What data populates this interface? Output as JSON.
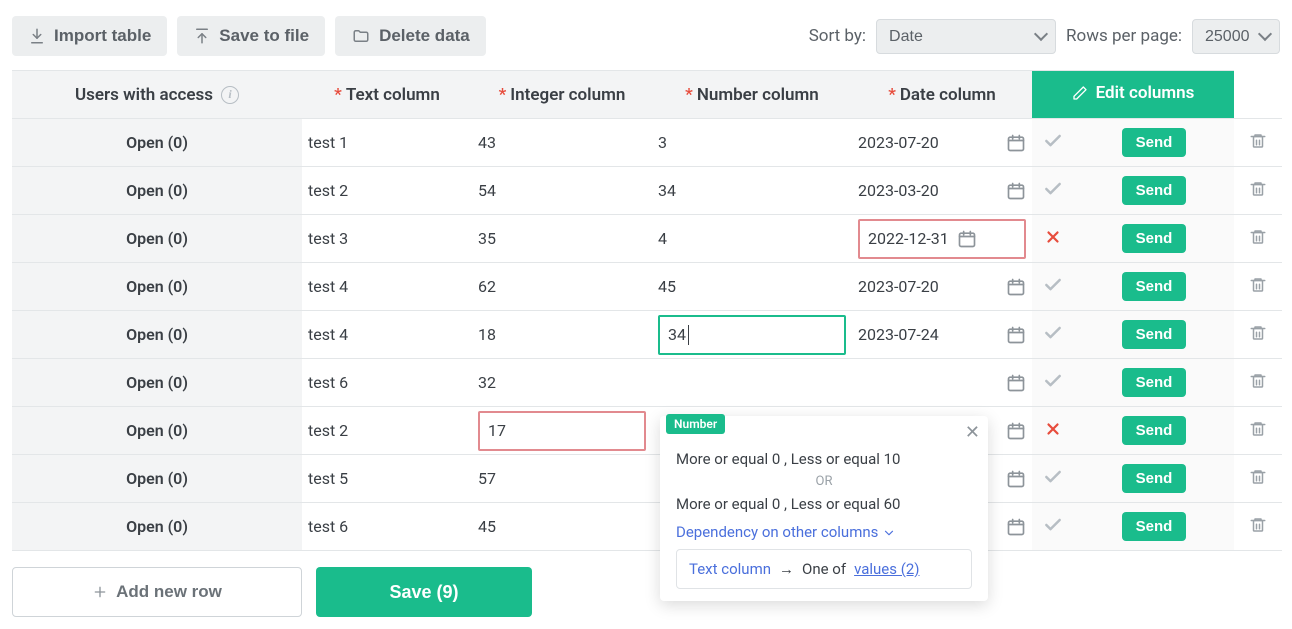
{
  "toolbar": {
    "import_label": "Import table",
    "save_file_label": "Save to file",
    "delete_data_label": "Delete data",
    "sort_by_label": "Sort by:",
    "sort_selected": "Date",
    "rows_label": "Rows per page:",
    "rows_selected": "25000"
  },
  "columns": {
    "users": "Users with access",
    "text": "Text column",
    "integer": "Integer column",
    "number": "Number column",
    "date": "Date column",
    "edit": "Edit columns"
  },
  "rows": [
    {
      "users": "Open (0)",
      "text": "test 1",
      "int": "43",
      "num": "3",
      "date": "2023-07-20",
      "status": "ok",
      "send": "Send"
    },
    {
      "users": "Open (0)",
      "text": "test 2",
      "int": "54",
      "num": "34",
      "date": "2023-03-20",
      "status": "ok",
      "send": "Send"
    },
    {
      "users": "Open (0)",
      "text": "test 3",
      "int": "35",
      "num": "4",
      "date": "2022-12-31",
      "status": "err",
      "send": "Send",
      "date_err": true
    },
    {
      "users": "Open (0)",
      "text": "test 4",
      "int": "62",
      "num": "45",
      "date": "2023-07-20",
      "status": "ok",
      "send": "Send"
    },
    {
      "users": "Open (0)",
      "text": "test 4",
      "int": "18",
      "num": "34",
      "date": "2023-07-24",
      "status": "ok",
      "send": "Send",
      "num_editing": true
    },
    {
      "users": "Open (0)",
      "text": "test 6",
      "int": "32",
      "num": "",
      "date": "",
      "status": "ok",
      "send": "Send"
    },
    {
      "users": "Open (0)",
      "text": "test 2",
      "int": "17",
      "num": "",
      "date": "",
      "status": "err",
      "send": "Send",
      "int_err": true
    },
    {
      "users": "Open (0)",
      "text": "test 5",
      "int": "57",
      "num": "",
      "date": "",
      "status": "ok",
      "send": "Send"
    },
    {
      "users": "Open (0)",
      "text": "test 6",
      "int": "45",
      "num": "",
      "date": "",
      "status": "ok",
      "send": "Send"
    }
  ],
  "popover": {
    "tag": "Number",
    "rule1": "More or equal 0 , Less or equal 10",
    "or": "OR",
    "rule2": "More or equal 0 , Less or equal 60",
    "dep_label": "Dependency on other columns",
    "dep_col": "Text column",
    "dep_arrow": "→",
    "dep_pred": "One of",
    "dep_link": "values (2)"
  },
  "footer": {
    "add_row": "Add new row",
    "save": "Save (9)"
  }
}
